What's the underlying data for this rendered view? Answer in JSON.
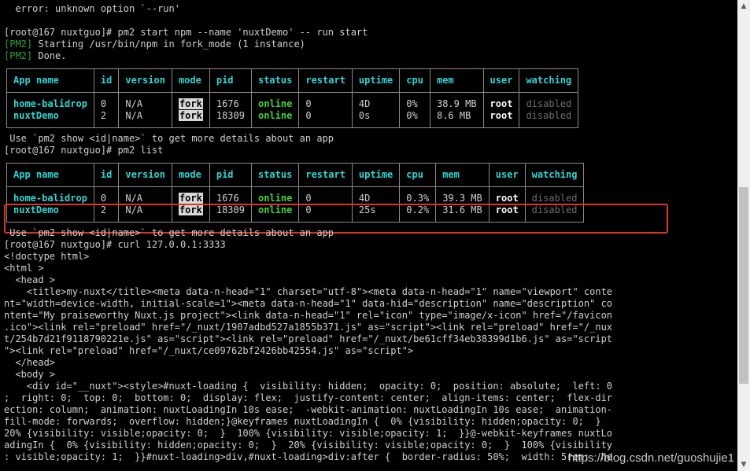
{
  "lines": {
    "err": "  error: unknown option `--run'",
    "cmd1": "[root@167 nuxtguo]# pm2 start npm --name 'nuxtDemo' -- run start",
    "pm2_tag": "[PM2]",
    "starting": " Starting /usr/bin/npm in fork_mode (1 instance)",
    "done": " Done.",
    "use1": " Use `pm2 show <id|name>` to get more details about an app",
    "cmd2": "[root@167 nuxtguo]# pm2 list",
    "use2": " Use `pm2 show <id|name>` to get more details about an app",
    "cmd3": "[root@167 nuxtguo]# curl 127.0.0.1:3333",
    "html": [
      "<!doctype html>",
      "<html >",
      "  <head >",
      "    <title>my-nuxt</title><meta data-n-head=\"1\" charset=\"utf-8\"><meta data-n-head=\"1\" name=\"viewport\" conte",
      "nt=\"width=device-width, initial-scale=1\"><meta data-n-head=\"1\" data-hid=\"description\" name=\"description\" co",
      "ntent=\"My praiseworthy Nuxt.js project\"><link data-n-head=\"1\" rel=\"icon\" type=\"image/x-icon\" href=\"/favicon",
      ".ico\"><link rel=\"preload\" href=\"/_nuxt/1907adbd527a1855b371.js\" as=\"script\"><link rel=\"preload\" href=\"/_nux",
      "t/254b7d21f9118790221e.js\" as=\"script\"><link rel=\"preload\" href=\"/_nuxt/be61cff34eb38399d1b6.js\" as=\"script",
      "\"><link rel=\"preload\" href=\"/_nuxt/ce09762bf2426bb42554.js\" as=\"script\">",
      "  </head>",
      "  <body >",
      "    <div id=\"__nuxt\"><style>#nuxt-loading {  visibility: hidden;  opacity: 0;  position: absolute;  left: 0",
      ";  right: 0;  top: 0;  bottom: 0;  display: flex;  justify-content: center;  align-items: center;  flex-dir",
      "ection: column;  animation: nuxtLoadingIn 10s ease;  -webkit-animation: nuxtLoadingIn 10s ease;  animation-",
      "fill-mode: forwards;  overflow: hidden;}@keyframes nuxtLoadingIn {  0% {visibility: hidden;opacity: 0;  }",
      "20% {visibility: visible;opacity: 0;  }  100% {visibility: visible;opacity: 1;  }}@-webkit-keyframes nuxtLo",
      "adingIn {  0% {visibility: hidden;opacity: 0;  }  20% {visibility: visible;opacity: 0;  }  100% {visibility",
      ": visible;opacity: 1;  }}#nuxt-loading>div,#nuxt-loading>div:after {  border-radius: 50%;  width: 5rem;  he"
    ]
  },
  "table_headers": [
    "App name",
    "id",
    "version",
    "mode",
    "pid",
    "status",
    "restart",
    "uptime",
    "cpu",
    "mem",
    "user",
    "watching"
  ],
  "table1": [
    [
      "home-balidrop",
      "0",
      "N/A",
      "fork",
      "1676",
      "online",
      "0",
      "4D",
      "0%",
      "38.9 MB",
      "root",
      "disabled"
    ],
    [
      "nuxtDemo",
      "2",
      "N/A",
      "fork",
      "18309",
      "online",
      "0",
      "0s",
      "0%",
      "8.6 MB",
      "root",
      "disabled"
    ]
  ],
  "table2": [
    [
      "home-balidrop",
      "0",
      "N/A",
      "fork",
      "1676",
      "online",
      "0",
      "4D",
      "0.3%",
      "39.3 MB",
      "root",
      "disabled"
    ],
    [
      "nuxtDemo",
      "2",
      "N/A",
      "fork",
      "18309",
      "online",
      "0",
      "25s",
      "0.2%",
      "31.6 MB",
      "root",
      "disabled"
    ]
  ],
  "watermark": "https://blog.csdn.net/guoshujie1",
  "colors": {
    "highlight": "#e0302a",
    "header": "#2fd4d4",
    "online": "#3fd43f",
    "pm2": "#2e9f2e"
  },
  "icons": {
    "scroll_up": "triangle-up-icon",
    "scroll_down": "triangle-down-icon"
  }
}
